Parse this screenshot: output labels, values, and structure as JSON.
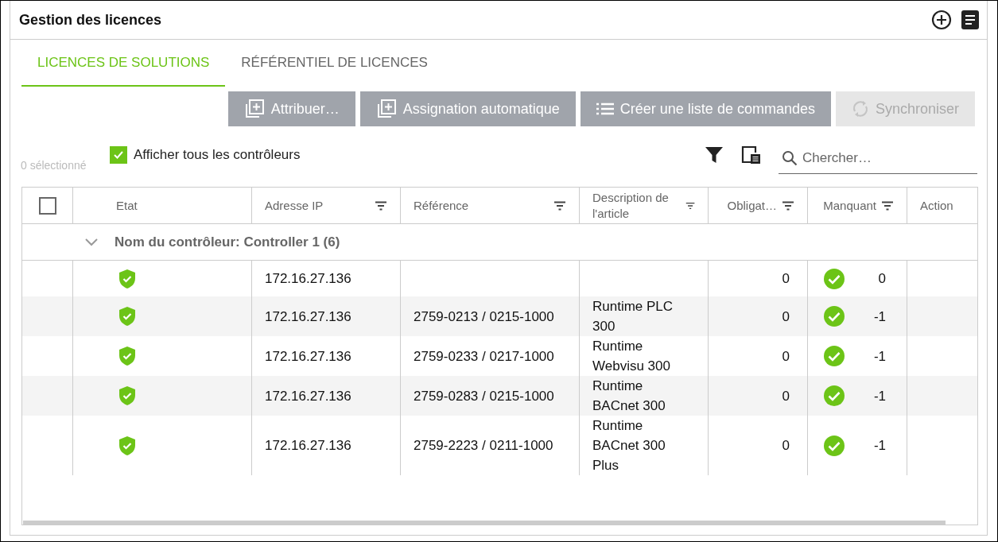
{
  "panel": {
    "title": "Gestion des licences"
  },
  "tabs": [
    {
      "label": "LICENCES DE SOLUTIONS",
      "selected": true
    },
    {
      "label": "RÉFÉRENTIEL DE LICENCES",
      "selected": false
    }
  ],
  "actions": [
    {
      "label": "Attribuer…",
      "kind": "add",
      "disabled": false
    },
    {
      "label": "Assignation automatique",
      "kind": "add",
      "disabled": false
    },
    {
      "label": "Créer une liste de commandes",
      "kind": "list",
      "disabled": false
    },
    {
      "label": "Synchroniser",
      "kind": "sync",
      "disabled": true
    }
  ],
  "selection_count": "0 sélectionné",
  "show_all": {
    "label": "Afficher tous les contrôleurs",
    "checked": true
  },
  "search": {
    "placeholder": "Chercher…"
  },
  "table": {
    "select_all": {
      "checked": false
    },
    "columns": [
      {
        "label": "Etat",
        "filter": false
      },
      {
        "label": "Adresse IP",
        "filter": true
      },
      {
        "label": "Référence",
        "filter": true
      },
      {
        "label": "Description de l'article",
        "filter": true
      },
      {
        "label": "Obligat…",
        "filter": true
      },
      {
        "label": "Manquant",
        "filter": true
      },
      {
        "label": "Action",
        "filter": false
      }
    ],
    "group": {
      "label": "Nom du contrôleur: Controller 1 (6)",
      "expanded": true
    },
    "rows": [
      {
        "ip": "172.16.27.136",
        "required": "0",
        "missing": "0"
      },
      {
        "ip": "172.16.27.136",
        "reference": "2759-0213 / 0215-1000",
        "description": "Runtime PLC 300",
        "required": "0",
        "missing": "-1"
      },
      {
        "ip": "172.16.27.136",
        "reference": "2759-0233 / 0217-1000",
        "description": "Runtime Webvisu 300",
        "required": "0",
        "missing": "-1"
      },
      {
        "ip": "172.16.27.136",
        "reference": "2759-0283 / 0215-1000",
        "description": "Runtime BACnet 300",
        "required": "0",
        "missing": "-1"
      },
      {
        "ip": "172.16.27.136",
        "reference": "2759-2223 / 0211-1000",
        "description": "Runtime BACnet 300 Plus",
        "required": "0",
        "missing": "-1"
      }
    ]
  }
}
